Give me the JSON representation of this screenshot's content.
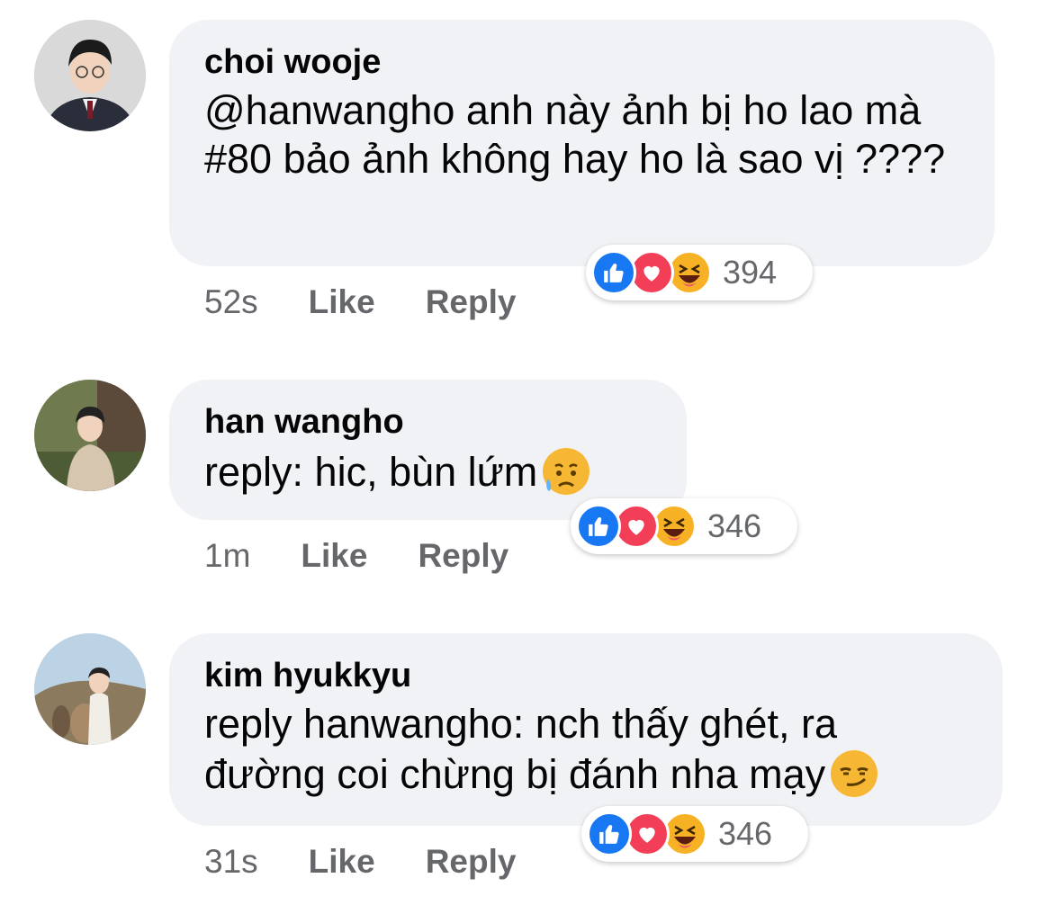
{
  "comments": [
    {
      "author": "choi wooje",
      "text": "@hanwangho anh này ảnh bị ho lao mà #80 bảo ảnh không hay ho là sao vị ????",
      "time": "52s",
      "like_label": "Like",
      "reply_label": "Reply",
      "reaction_count": "394",
      "reactions": [
        "like-icon",
        "love-icon",
        "haha-icon"
      ]
    },
    {
      "author": "han wangho",
      "text": "reply: hic, bùn lứm",
      "inline_emoji": "sad-sweat-emoji",
      "time": "1m",
      "like_label": "Like",
      "reply_label": "Reply",
      "reaction_count": "346",
      "reactions": [
        "like-icon",
        "love-icon",
        "haha-icon"
      ]
    },
    {
      "author": "kim hyukkyu",
      "text": "reply hanwangho: nch thấy ghét, ra đường coi chừng bị đánh nha mạy",
      "inline_emoji": "smirk-emoji",
      "time": "31s",
      "like_label": "Like",
      "reply_label": "Reply",
      "reaction_count": "346",
      "reactions": [
        "like-icon",
        "love-icon",
        "haha-icon"
      ]
    }
  ],
  "colors": {
    "bubble": "#f0f2f5",
    "text": "#050505",
    "meta": "#65676b",
    "like": "#1877f2",
    "love": "#f33e58",
    "haha": "#f7b125"
  }
}
